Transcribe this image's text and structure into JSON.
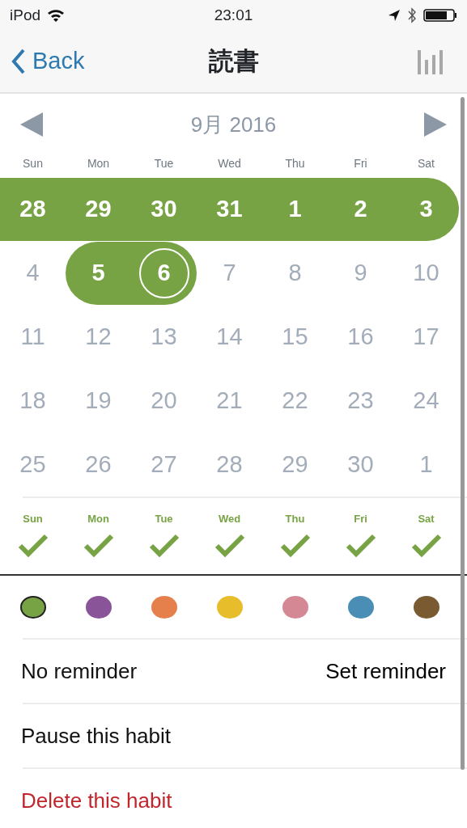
{
  "status_bar": {
    "device": "iPod",
    "time": "23:01"
  },
  "nav": {
    "back": "Back",
    "title": "読書"
  },
  "calendar": {
    "month": "9月 2016",
    "weekdays": [
      "Sun",
      "Mon",
      "Tue",
      "Wed",
      "Thu",
      "Fri",
      "Sat"
    ],
    "weeks": [
      [
        {
          "day": "28",
          "done": true,
          "today": false
        },
        {
          "day": "29",
          "done": true,
          "today": false
        },
        {
          "day": "30",
          "done": true,
          "today": false
        },
        {
          "day": "31",
          "done": true,
          "today": false
        },
        {
          "day": "1",
          "done": true,
          "today": false
        },
        {
          "day": "2",
          "done": true,
          "today": false
        },
        {
          "day": "3",
          "done": true,
          "today": false
        }
      ],
      [
        {
          "day": "4",
          "done": false,
          "today": false
        },
        {
          "day": "5",
          "done": true,
          "today": false
        },
        {
          "day": "6",
          "done": true,
          "today": true
        },
        {
          "day": "7",
          "done": false,
          "today": false
        },
        {
          "day": "8",
          "done": false,
          "today": false
        },
        {
          "day": "9",
          "done": false,
          "today": false
        },
        {
          "day": "10",
          "done": false,
          "today": false
        }
      ],
      [
        {
          "day": "11",
          "done": false,
          "today": false
        },
        {
          "day": "12",
          "done": false,
          "today": false
        },
        {
          "day": "13",
          "done": false,
          "today": false
        },
        {
          "day": "14",
          "done": false,
          "today": false
        },
        {
          "day": "15",
          "done": false,
          "today": false
        },
        {
          "day": "16",
          "done": false,
          "today": false
        },
        {
          "day": "17",
          "done": false,
          "today": false
        }
      ],
      [
        {
          "day": "18",
          "done": false,
          "today": false
        },
        {
          "day": "19",
          "done": false,
          "today": false
        },
        {
          "day": "20",
          "done": false,
          "today": false
        },
        {
          "day": "21",
          "done": false,
          "today": false
        },
        {
          "day": "22",
          "done": false,
          "today": false
        },
        {
          "day": "23",
          "done": false,
          "today": false
        },
        {
          "day": "24",
          "done": false,
          "today": false
        }
      ],
      [
        {
          "day": "25",
          "done": false,
          "today": false
        },
        {
          "day": "26",
          "done": false,
          "today": false
        },
        {
          "day": "27",
          "done": false,
          "today": false
        },
        {
          "day": "28",
          "done": false,
          "today": false
        },
        {
          "day": "29",
          "done": false,
          "today": false
        },
        {
          "day": "30",
          "done": false,
          "today": false
        },
        {
          "day": "1",
          "done": false,
          "today": false
        }
      ]
    ]
  },
  "schedule": [
    {
      "label": "Sun",
      "checked": true
    },
    {
      "label": "Mon",
      "checked": true
    },
    {
      "label": "Tue",
      "checked": true
    },
    {
      "label": "Wed",
      "checked": true
    },
    {
      "label": "Thu",
      "checked": true
    },
    {
      "label": "Fri",
      "checked": true
    },
    {
      "label": "Sat",
      "checked": true
    }
  ],
  "colors": [
    {
      "color": "#78a345",
      "selected": true
    },
    {
      "color": "#8a5499",
      "selected": false
    },
    {
      "color": "#e5804d",
      "selected": false
    },
    {
      "color": "#e8bd2c",
      "selected": false
    },
    {
      "color": "#d48894",
      "selected": false
    },
    {
      "color": "#4a8db5",
      "selected": false
    },
    {
      "color": "#7a5a31",
      "selected": false
    }
  ],
  "reminder": {
    "status": "No reminder",
    "action": "Set reminder"
  },
  "actions": [
    {
      "label": "Pause this habit",
      "kind": "normal"
    },
    {
      "label": "Delete this habit",
      "kind": "danger"
    }
  ]
}
